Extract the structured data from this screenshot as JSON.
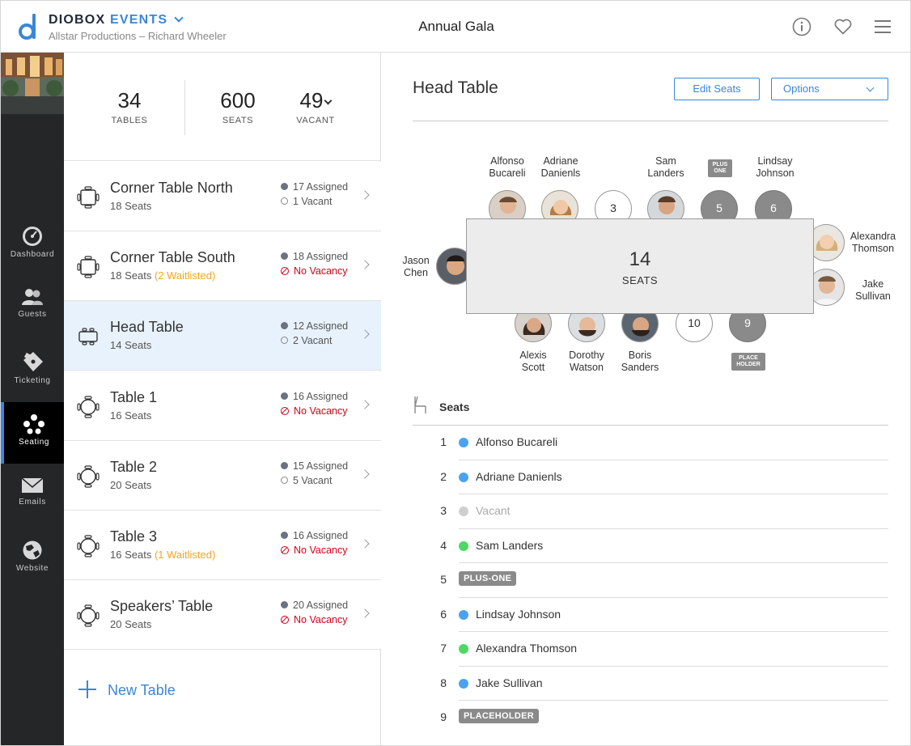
{
  "header": {
    "brand_main": "DIOBOX",
    "brand_accent": "EVENTS",
    "subtitle": "Allstar Productions – Richard Wheeler",
    "event_title": "Annual Gala",
    "icons": [
      "info-icon",
      "heart-icon",
      "hamburger-menu-icon"
    ]
  },
  "nav": {
    "items": [
      {
        "label": "Dashboard",
        "icon": "speedometer-icon"
      },
      {
        "label": "Guests",
        "icon": "guests-icon"
      },
      {
        "label": "Ticketing",
        "icon": "ticket-icon"
      },
      {
        "label": "Seating",
        "icon": "seating-icon",
        "active": true
      },
      {
        "label": "Emails",
        "icon": "envelope-icon"
      },
      {
        "label": "Website",
        "icon": "globe-icon"
      }
    ]
  },
  "stats": {
    "tables": {
      "value": "34",
      "label": "TABLES"
    },
    "seats": {
      "value": "600",
      "label": "SEATS"
    },
    "vacant": {
      "value": "49",
      "label": "VACANT"
    }
  },
  "tables": [
    {
      "name": "Corner Table North",
      "seats": "18 Seats",
      "waitlist": "",
      "assigned": "17 Assigned",
      "vacancy": "1 Vacant",
      "no_vacancy": false,
      "shape": "square"
    },
    {
      "name": "Corner Table South",
      "seats": "18 Seats",
      "waitlist": "(2 Waitlisted)",
      "assigned": "18 Assigned",
      "vacancy": "No Vacancy",
      "no_vacancy": true,
      "shape": "square"
    },
    {
      "name": "Head Table",
      "seats": "14 Seats",
      "waitlist": "",
      "assigned": "12 Assigned",
      "vacancy": "2 Vacant",
      "no_vacancy": false,
      "shape": "rect",
      "selected": true
    },
    {
      "name": "Table 1",
      "seats": "16 Seats",
      "waitlist": "",
      "assigned": "16 Assigned",
      "vacancy": "No Vacancy",
      "no_vacancy": true,
      "shape": "round"
    },
    {
      "name": "Table 2",
      "seats": "20 Seats",
      "waitlist": "",
      "assigned": "15 Assigned",
      "vacancy": "5 Vacant",
      "no_vacancy": false,
      "shape": "round"
    },
    {
      "name": "Table 3",
      "seats": "16 Seats",
      "waitlist": "(1 Waitlisted)",
      "assigned": "16 Assigned",
      "vacancy": "No Vacancy",
      "no_vacancy": true,
      "shape": "round"
    },
    {
      "name": "Speakers’ Table",
      "seats": "20 Seats",
      "waitlist": "",
      "assigned": "20 Assigned",
      "vacancy": "No Vacancy",
      "no_vacancy": true,
      "shape": "round"
    }
  ],
  "new_table_label": "New Table",
  "detail": {
    "title": "Head Table",
    "edit_seats_label": "Edit Seats",
    "options_label": "Options",
    "table_center": {
      "count": "14",
      "label": "SEATS"
    },
    "diagram_names": {
      "top1": [
        "Alfonso",
        "Bucareli"
      ],
      "top2": [
        "Adriane",
        "Danienls"
      ],
      "top4": [
        "Sam",
        "Landers"
      ],
      "top6": [
        "Lindsay",
        "Johnson"
      ],
      "right7": [
        "Alexandra",
        "Thomson"
      ],
      "right8": [
        "Jake",
        "Sullivan"
      ],
      "left": [
        "Jason",
        "Chen"
      ],
      "bottom1": [
        "Alexis",
        "Scott"
      ],
      "bottom2": [
        "Dorothy",
        "Watson"
      ],
      "bottom3": [
        "Boris",
        "Sanders"
      ]
    },
    "seat_numbers": {
      "s3": "3",
      "s5": "5",
      "s6": "6",
      "s10": "10",
      "s9": "9"
    },
    "tags": {
      "plus_one": "PLUS ONE",
      "placeholder": "PLACE HOLDER"
    },
    "seats_header": "Seats",
    "seats": [
      {
        "num": "1",
        "name": "Alfonso Bucareli",
        "color": "#4aa3f0"
      },
      {
        "num": "2",
        "name": "Adriane Danienls",
        "color": "#4aa3f0"
      },
      {
        "num": "3",
        "name": "Vacant",
        "color": "#cfcfcf",
        "vacant": true
      },
      {
        "num": "4",
        "name": "Sam Landers",
        "color": "#4cd964"
      },
      {
        "num": "5",
        "pill": "PLUS-ONE"
      },
      {
        "num": "6",
        "name": "Lindsay Johnson",
        "color": "#4aa3f0"
      },
      {
        "num": "7",
        "name": "Alexandra Thomson",
        "color": "#4cd964"
      },
      {
        "num": "8",
        "name": "Jake Sullivan",
        "color": "#4aa3f0"
      },
      {
        "num": "9",
        "pill": "PLACEHOLDER"
      }
    ]
  }
}
